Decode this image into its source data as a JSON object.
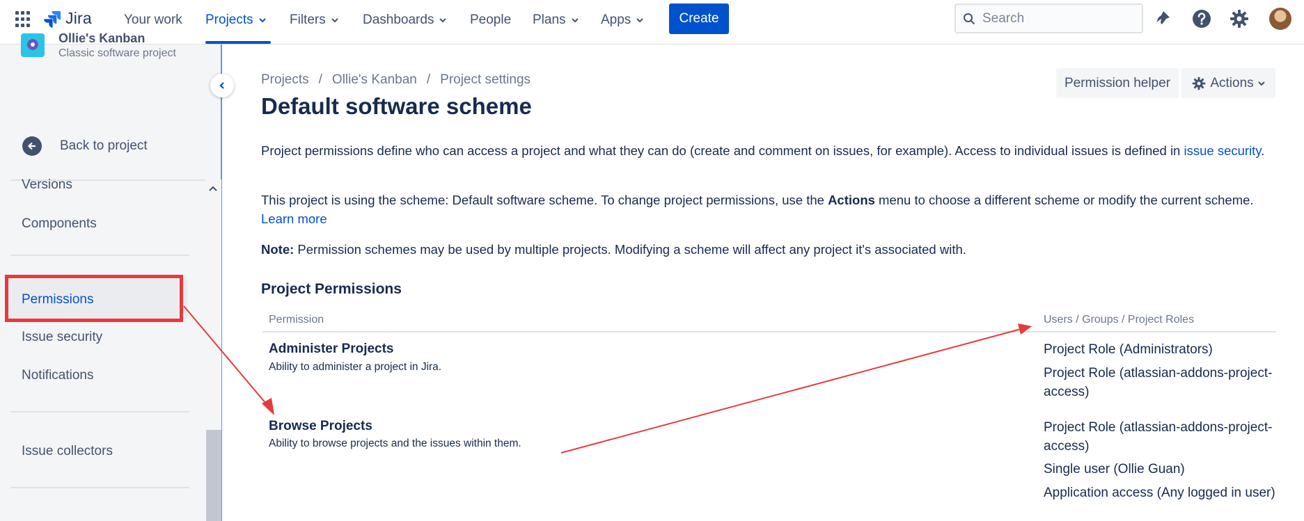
{
  "topnav": {
    "brand": "Jira",
    "items": [
      {
        "label": "Your work"
      },
      {
        "label": "Projects"
      },
      {
        "label": "Filters"
      },
      {
        "label": "Dashboards"
      },
      {
        "label": "People"
      },
      {
        "label": "Plans"
      },
      {
        "label": "Apps"
      }
    ],
    "create_label": "Create",
    "search_placeholder": "Search"
  },
  "sidebar": {
    "project_name": "Ollie's Kanban",
    "project_type": "Classic software project",
    "back_label": "Back to project",
    "items": [
      "Versions",
      "Components",
      "Permissions",
      "Issue security",
      "Notifications",
      "Issue collectors"
    ],
    "selected": "Permissions"
  },
  "main": {
    "breadcrumb": [
      "Projects",
      "Ollie's Kanban",
      "Project settings"
    ],
    "breadcrumb_sep": "/",
    "title": "Default software scheme",
    "permission_helper_label": "Permission helper",
    "actions_label": "Actions",
    "intro_text": "Project permissions define who can access a project and what they can do (create and comment on issues, for example). Access to individual issues is defined in",
    "intro_link": "issue security",
    "scheme_text_1": "This project is using the scheme: Default software scheme. To change project permissions, use the",
    "scheme_text_bold": "Actions",
    "scheme_text_2": "menu to choose a different scheme or modify the current scheme.",
    "learn_more": "Learn more",
    "note_label": "Note:",
    "note_text": "Permission schemes may be used by multiple projects. Modifying a scheme will affect any project it's associated with.",
    "section_title": "Project Permissions",
    "columns": [
      "Permission",
      "Users / Groups / Project Roles"
    ],
    "permissions": [
      {
        "name": "Administer Projects",
        "description": "Ability to administer a project in Jira.",
        "grants": [
          "Project Role (Administrators)",
          "Project Role (atlassian-addons-project-access)"
        ]
      },
      {
        "name": "Browse Projects",
        "description": "Ability to browse projects and the issues within them.",
        "grants": [
          "Project Role (atlassian-addons-project-access)",
          "Single user (Ollie Guan)",
          "Application access (Any logged in user)"
        ]
      }
    ]
  },
  "colors": {
    "accent": "#0052cc",
    "annotation": "#e8393d"
  }
}
